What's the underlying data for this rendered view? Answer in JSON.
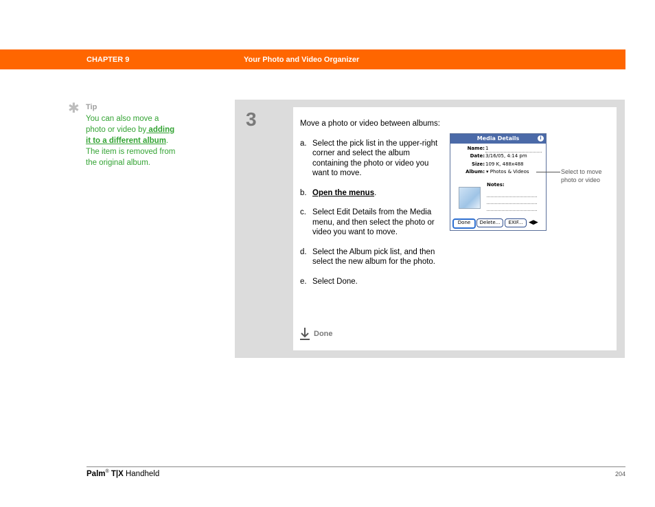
{
  "header": {
    "chapter": "CHAPTER 9",
    "title": "Your Photo and Video Organizer",
    "bar_color": "#ff6600"
  },
  "tip": {
    "icon": "asterisk-icon",
    "label": "Tip",
    "line1": "You can also move a",
    "line2_pre": "photo or video by",
    "line2_link": " adding ",
    "line3_link": "it to a different album",
    "line3_post": ".",
    "line4": "The item is removed from",
    "line5": "the original album.",
    "color": "#33a333"
  },
  "step": {
    "number": "3",
    "intro": "Move a photo or video between albums:",
    "items": [
      {
        "label": "a.",
        "text": "Select the pick list in the upper-right corner and select the album containing the photo or video you want to move."
      },
      {
        "label": "b.",
        "link": "Open the menus",
        "post": "."
      },
      {
        "label": "c.",
        "text": "Select Edit Details from the Media menu, and then select the photo or video you want to move."
      },
      {
        "label": "d.",
        "text": "Select the Album pick list, and then select the new album for the photo."
      },
      {
        "label": "e.",
        "text": "Select Done."
      }
    ],
    "done_label": "Done"
  },
  "palm_screen": {
    "title": "Media Details",
    "name_label": "Name:",
    "name_value": "1",
    "date_label": "Date:",
    "date_value": "3/16/05, 4:14 pm",
    "size_label": "Size:",
    "size_value": "109 K, 488x488",
    "album_label": "Album:",
    "album_value": "Photos & Videos",
    "notes_label": "Notes:",
    "buttons": {
      "done": "Done",
      "delete": "Delete...",
      "exif": "EXIF..."
    }
  },
  "callout": {
    "text": "Select to move photo or video"
  },
  "footer": {
    "brand": "Palm",
    "reg": "®",
    "model": " T|X",
    "product": " Handheld",
    "page": "204"
  }
}
